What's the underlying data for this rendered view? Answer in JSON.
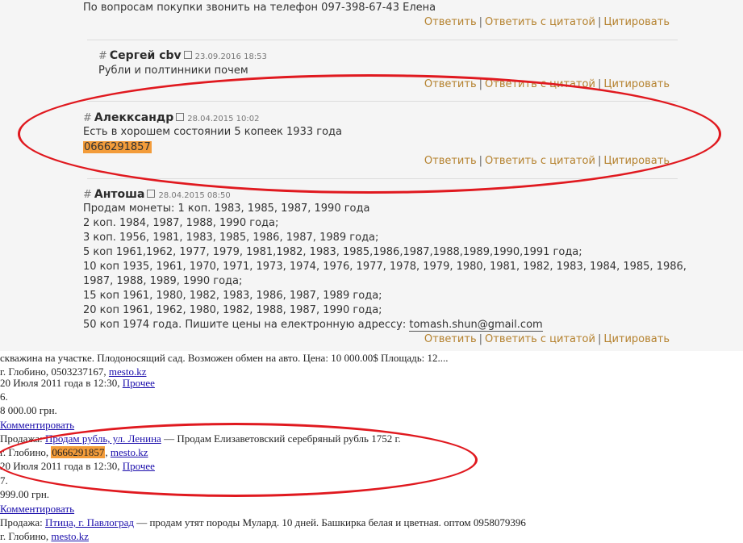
{
  "actions": {
    "reply": "Ответить",
    "reply_quote": "Ответить с цитатой",
    "quote": "Цитировать",
    "sep": "|"
  },
  "forum": {
    "top_text": "По вопросам покупки звонить на телефон 097-398-67-43 Елена",
    "comments": [
      {
        "author": "Сергей cbv",
        "date": "23.09.2016 18:53",
        "lines": [
          "Рубли и полтинники почем"
        ]
      },
      {
        "author": "Алекксандр",
        "date": "28.04.2015 10:02",
        "lines": [
          "Есть в хорошем состоянии 5 копеек 1933 года"
        ],
        "phone": "0666291857"
      },
      {
        "author": "Антоша",
        "date": "28.04.2015 08:50",
        "lines": [
          "Продам монеты: 1 коп. 1983, 1985, 1987, 1990 года",
          "2 коп. 1984, 1987, 1988, 1990 года;",
          "3 коп. 1956, 1981, 1983, 1985, 1986, 1987, 1989 года;",
          "5 коп 1961,1962, 1977, 1979, 1981,1982, 1983, 1985,1986,1987,1988,1989,1990,1991 года;",
          "10 коп 1935, 1961, 1970, 1971, 1973, 1974, 1976, 1977, 1978, 1979, 1980, 1981, 1982, 1983, 1984, 1985, 1986,",
          "1987, 1988, 1989, 1990 года;",
          "15 коп 1961, 1980, 1982, 1983, 1986, 1987, 1989 года;",
          "20 коп 1961, 1962, 1980, 1982, 1988, 1987, 1990 года;"
        ],
        "last_line": "50 коп 1974 года. Пишите цены на електронную адрессу:",
        "email": "tomash.shun@gmail.com"
      }
    ]
  },
  "classifieds": {
    "r1": "скважина на участке. Плодоносящий сад. Возможен обмен на авто. Цена: 10 000.00$ Площадь: 12....",
    "r2_prefix": "г. Глобино, 0503237167, ",
    "site": "mesto.kz",
    "r3_prefix": "20 Июля 2011 года в 12:30, ",
    "category": "Прочее",
    "r4": "6.",
    "r5": "8 000.00 грн.",
    "comment_link": "Комментировать",
    "r7_prefix": "Продажа: ",
    "r7_link": "Продам рубль, ул. Ленина",
    "r7_suffix": " — Продам Елизаветовский серебряный рубль 1752 г.",
    "r8_prefix": "г. Глобино, ",
    "r8_phone": "0666291857",
    "r8_sep": ", ",
    "r9_prefix": "20 Июля 2011 года в 12:30, ",
    "r10": "7.",
    "r11": "999.00 грн.",
    "r13_prefix": "Продажа: ",
    "r13_link": "Птица, г. Павлоград",
    "r13_suffix": " — продам утят породы Мулард. 10 дней. Башкирка белая и цветная. оптом 0958079396",
    "r14_prefix": "г. Глобино, "
  }
}
